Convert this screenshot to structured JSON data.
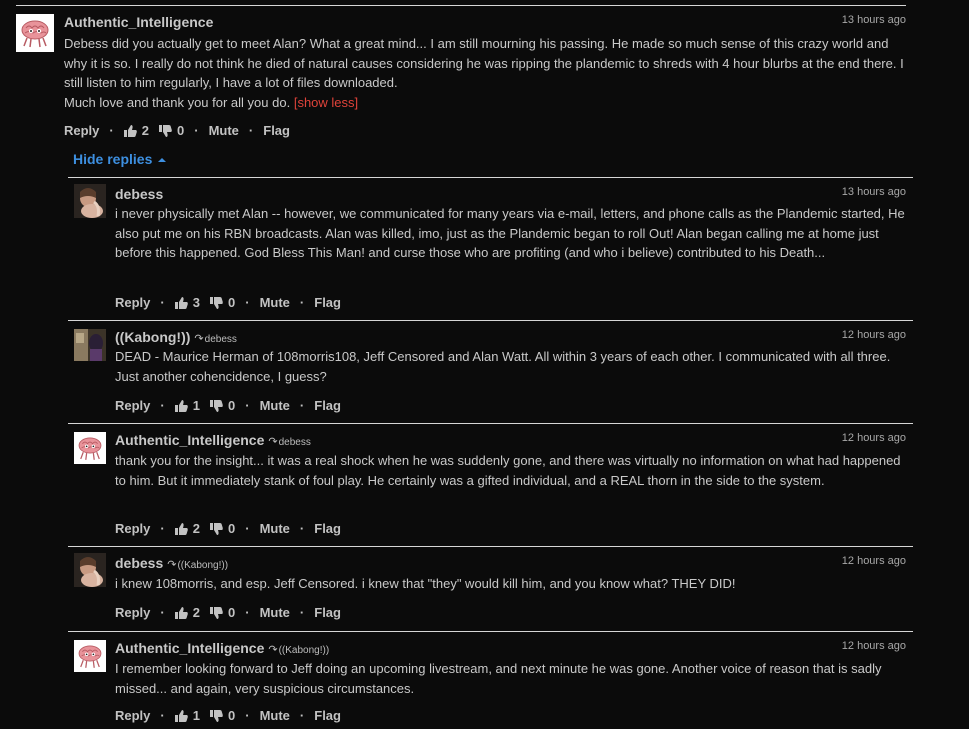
{
  "labels": {
    "reply": "Reply",
    "mute": "Mute",
    "flag": "Flag",
    "show_less": "[show less]",
    "hide_replies": "Hide replies",
    "separator": "·"
  },
  "comments": [
    {
      "author": "Authentic_Intelligence",
      "reply_to": "",
      "time": "13 hours ago",
      "text": "Debess did you actually get to meet Alan? What a great mind... I am still mourning his passing. He made so much sense of this crazy world and why it is so. I really do not think he died of natural causes considering he was ripping the plandemic to shreds with 4 hour blurbs at the end there. I still listen to him regularly, I have a lot of files downloaded.",
      "text2": "Much love and thank you for all you do.",
      "upvotes": "2",
      "downvotes": "0",
      "avatar": "brain-avatar"
    },
    {
      "author": "debess",
      "reply_to": "",
      "time": "13 hours ago",
      "text": "i never physically met Alan -- however, we communicated for many years via e-mail, letters, and phone calls as the Plandemic started, He also put me on his RBN broadcasts. Alan was killed, imo, just as the Plandemic began to roll Out! Alan began calling me at home just before this happened. God Bless This Man! and curse those who are profiting (and who i believe) contributed to his Death...",
      "upvotes": "3",
      "downvotes": "0",
      "avatar": "photo-avatar"
    },
    {
      "author": "((Kabong!))",
      "reply_to": "debess",
      "time": "12 hours ago",
      "text": "DEAD - Maurice Herman of 108morris108, Jeff Censored and Alan Watt. All within 3 years of each other. I communicated with all three. Just another cohencidence, I guess?",
      "upvotes": "1",
      "downvotes": "0",
      "avatar": "kabong-avatar"
    },
    {
      "author": "Authentic_Intelligence",
      "reply_to": "debess",
      "time": "12 hours ago",
      "text": "thank you for the insight... it was a real shock when he was suddenly gone, and there was virtually no information on what had happened to him. But it immediately stank of foul play. He certainly was a gifted individual, and a REAL thorn in the side to the system.",
      "upvotes": "2",
      "downvotes": "0",
      "avatar": "brain-avatar"
    },
    {
      "author": "debess",
      "reply_to": "((Kabong!))",
      "time": "12 hours ago",
      "text": "i knew 108morris, and esp. Jeff Censored. i knew that \"they\" would kill him, and you know what? THEY DID!",
      "upvotes": "2",
      "downvotes": "0",
      "avatar": "photo-avatar"
    },
    {
      "author": "Authentic_Intelligence",
      "reply_to": "((Kabong!))",
      "time": "12 hours ago",
      "text": "I remember looking forward to Jeff doing an upcoming livestream, and next minute he was gone. Another voice of reason that is sadly missed... and again, very suspicious circumstances.",
      "upvotes": "1",
      "downvotes": "0",
      "avatar": "brain-avatar"
    }
  ]
}
